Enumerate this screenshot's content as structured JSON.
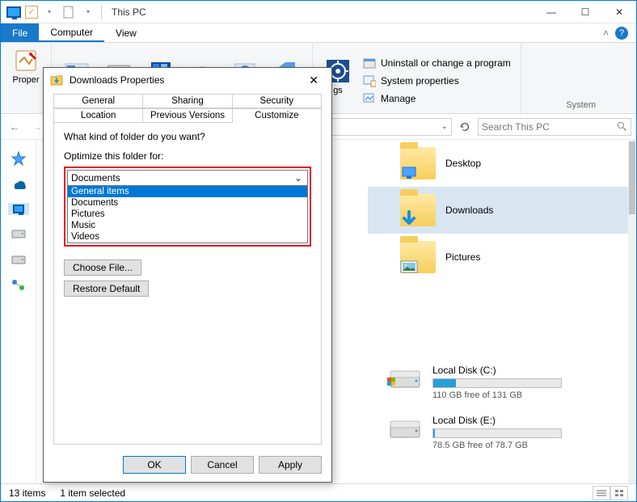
{
  "titlebar": {
    "title": "This PC"
  },
  "window_buttons": {
    "min": "—",
    "max": "☐",
    "close": "✕"
  },
  "ribbon_tabs": {
    "file": "File",
    "computer": "Computer",
    "view": "View"
  },
  "ribbon": {
    "properties": "Proper",
    "uninstall": "Uninstall or change a program",
    "sysprops": "System properties",
    "manage": "Manage",
    "system_group": "System"
  },
  "nav": {
    "search_placeholder": "Search This PC"
  },
  "folders": [
    {
      "label": "Desktop"
    },
    {
      "label": "Downloads",
      "selected": true
    },
    {
      "label": "Pictures"
    }
  ],
  "drives": [
    {
      "label": "Local Disk (C:)",
      "caption": "110 GB free of 131 GB",
      "fill_pct": 18
    },
    {
      "label": "Local Disk (E:)",
      "caption": "78.5 GB free of 78.7 GB",
      "fill_pct": 1
    }
  ],
  "statusbar": {
    "items": "13 items",
    "selected": "1 item selected"
  },
  "dialog": {
    "title": "Downloads Properties",
    "tabs": {
      "general": "General",
      "sharing": "Sharing",
      "security": "Security",
      "location": "Location",
      "previous": "Previous Versions",
      "customize": "Customize"
    },
    "q1": "What kind of folder do you want?",
    "q2": "Optimize this folder for:",
    "combo_value": "Documents",
    "options": [
      "General items",
      "Documents",
      "Pictures",
      "Music",
      "Videos"
    ],
    "choose_file": "Choose File...",
    "restore_default": "Restore Default",
    "ok": "OK",
    "cancel": "Cancel",
    "apply": "Apply"
  }
}
